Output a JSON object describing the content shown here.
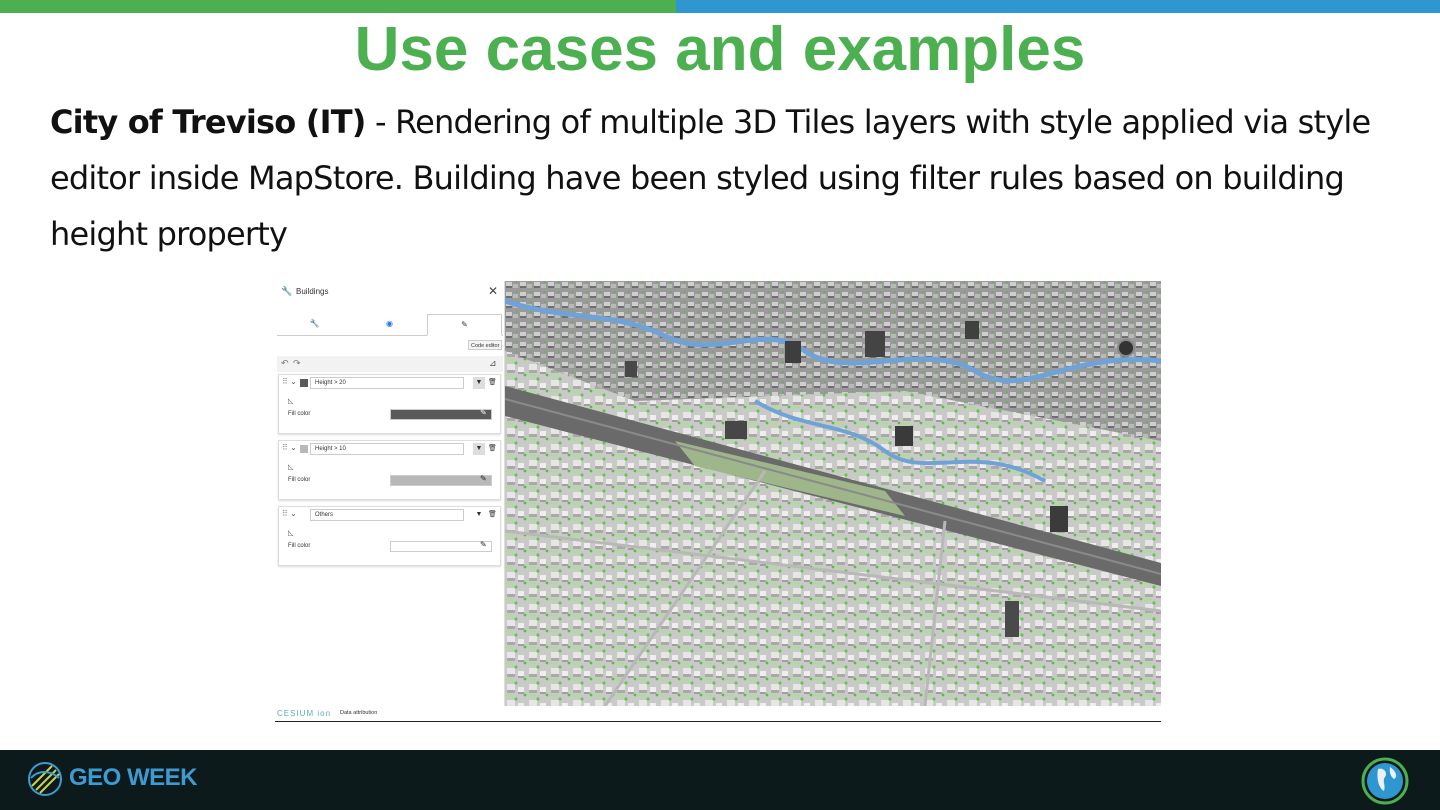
{
  "colors": {
    "green": "#4caf50",
    "blue": "#2f97d0",
    "title": "#4caf50",
    "footer_bg": "#0d1a1c",
    "brand": "#3d9bd1"
  },
  "title": "Use cases and examples",
  "body": {
    "bold": "City of Treviso (IT)",
    "rest": " - Rendering of multiple 3D Tiles layers with style applied via style editor inside MapStore. Building have been styled using filter rules based on building height property"
  },
  "screenshot": {
    "panel": {
      "title": "Buildings",
      "close_icon": "close-icon",
      "tabs": [
        {
          "icon": "wrench-icon",
          "glyph": "🔧"
        },
        {
          "icon": "eye-icon",
          "glyph": "◉"
        },
        {
          "icon": "brush-icon",
          "glyph": "✎"
        }
      ],
      "tooltip": "Code editor",
      "rules": [
        {
          "name": "Height > 20",
          "fill_label": "Fill color",
          "color": "#5a5a5a",
          "has_filter": true
        },
        {
          "name": "Height > 10",
          "fill_label": "Fill color",
          "color": "#b8b8b8",
          "has_filter": true
        },
        {
          "name": "Others",
          "fill_label": "Fill color",
          "color": "#ffffff",
          "has_filter": false
        }
      ]
    },
    "statusbar": {
      "logo": "CESIUM ion",
      "attribution": "Data attribution"
    }
  },
  "footer": {
    "brand": "GEO WEEK"
  }
}
